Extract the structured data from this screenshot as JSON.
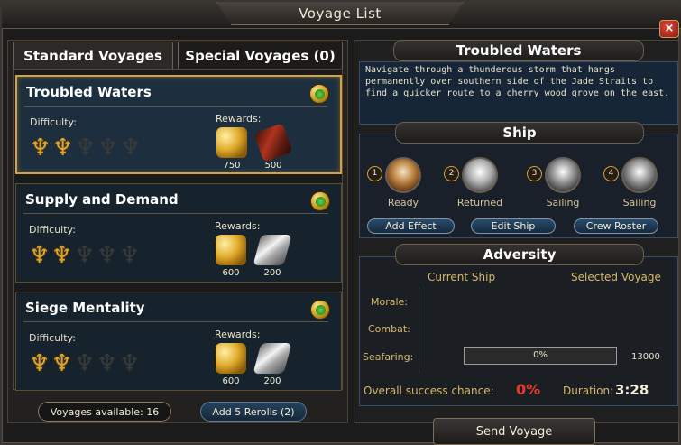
{
  "window": {
    "title": "Voyage List",
    "close_label": "×"
  },
  "tabs": [
    {
      "label": "Standard Voyages",
      "active": true
    },
    {
      "label": "Special Voyages (0)",
      "active": false
    }
  ],
  "voyages": [
    {
      "name": "Troubled Waters",
      "selected": true,
      "difficulty_label": "Difficulty:",
      "difficulty": 2,
      "difficulty_max": 5,
      "rewards_label": "Rewards:",
      "rewards": [
        {
          "icon": "gold-icon",
          "amount": "750"
        },
        {
          "icon": "wood-icon",
          "amount": "500"
        }
      ]
    },
    {
      "name": "Supply and Demand",
      "selected": false,
      "difficulty_label": "Difficulty:",
      "difficulty": 2,
      "difficulty_max": 5,
      "rewards_label": "Rewards:",
      "rewards": [
        {
          "icon": "gold-icon",
          "amount": "600"
        },
        {
          "icon": "silver-icon",
          "amount": "200"
        }
      ]
    },
    {
      "name": "Siege Mentality",
      "selected": false,
      "difficulty_label": "Difficulty:",
      "difficulty": 2,
      "difficulty_max": 5,
      "rewards_label": "Rewards:",
      "rewards": [
        {
          "icon": "gold-icon",
          "amount": "600"
        },
        {
          "icon": "silver-icon",
          "amount": "200"
        }
      ]
    }
  ],
  "footer": {
    "voyages_available": "Voyages available: 16",
    "add_rerolls": "Add 5 Rerolls (2)"
  },
  "detail": {
    "title": "Troubled Waters",
    "description": "Navigate through a thunderous storm that hangs permanently over southern side of the Jade Straits to find a quicker route to a cherry wood grove on the east."
  },
  "ship": {
    "header": "Ship",
    "slots": [
      {
        "number": "1",
        "status": "Ready"
      },
      {
        "number": "2",
        "status": "Returned"
      },
      {
        "number": "3",
        "status": "Sailing"
      },
      {
        "number": "4",
        "status": "Sailing"
      }
    ],
    "buttons": {
      "add_effect": "Add Effect",
      "edit_ship": "Edit Ship",
      "crew_roster": "Crew Roster"
    }
  },
  "adversity": {
    "header": "Adversity",
    "col_current": "Current Ship",
    "col_selected": "Selected Voyage",
    "rows": {
      "morale": "Morale:",
      "combat": "Combat:",
      "seafaring": "Seafaring:"
    },
    "seafaring_progress": 0,
    "seafaring_progress_label": "0%",
    "seafaring_max": "13000",
    "success_label": "Overall success chance:",
    "success_value": "0%",
    "duration_label": "Duration:",
    "duration_value": "3:28"
  },
  "send_button": "Send Voyage",
  "colors": {
    "accent_gold": "#d8a23a",
    "success_red": "#e33a2c",
    "panel_blue": "#172636"
  }
}
